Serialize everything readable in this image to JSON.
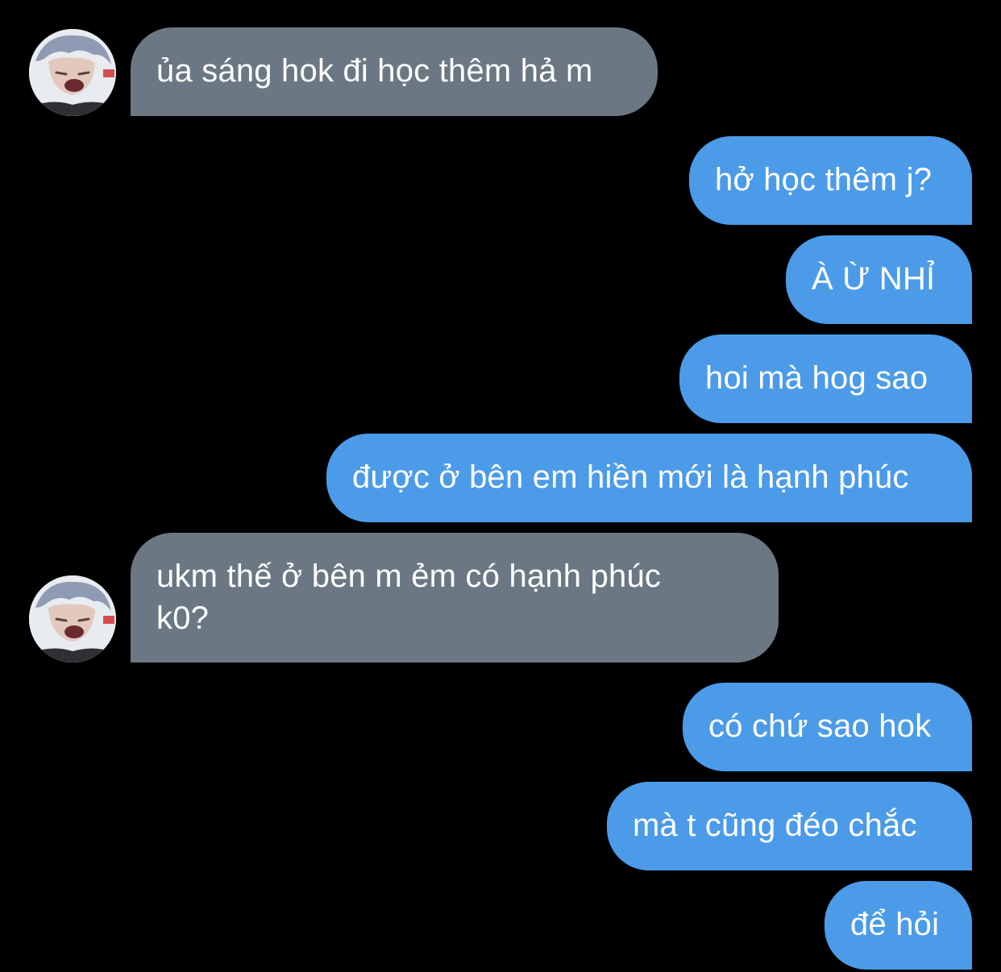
{
  "conversation": {
    "messages": [
      {
        "from": "them",
        "text": "ủa sáng hok đi học thêm hả m"
      },
      {
        "from": "me",
        "text": "hở học thêm j?"
      },
      {
        "from": "me",
        "text": "À Ừ NHỈ"
      },
      {
        "from": "me",
        "text": "hoi mà hog sao"
      },
      {
        "from": "me",
        "text": "được ở bên em hiền mới là hạnh phúc"
      },
      {
        "from": "them",
        "text": "ukm thế ở bên m ẻm có hạnh phúc k0?"
      },
      {
        "from": "me",
        "text": "có chứ sao hok"
      },
      {
        "from": "me",
        "text": "mà t cũng đéo chắc"
      },
      {
        "from": "me",
        "text": "để hỏi"
      }
    ]
  },
  "colors": {
    "background": "#000000",
    "incoming_bubble": "#6b7884",
    "outgoing_bubble": "#4c9be8",
    "text": "#ffffff"
  },
  "icons": {
    "avatar": "contact-avatar-photo"
  }
}
